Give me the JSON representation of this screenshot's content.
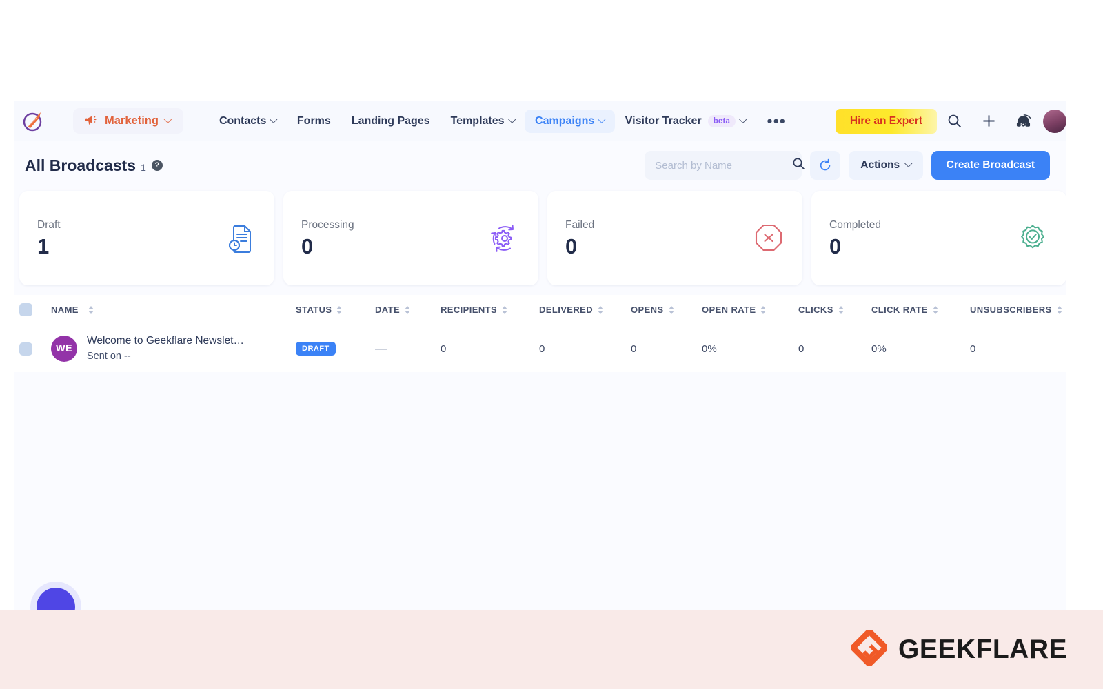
{
  "topnav": {
    "brand_icon": "geekflare-rocket-logo",
    "workspace": {
      "label": "Marketing",
      "icon": "megaphone-icon"
    },
    "items": [
      {
        "label": "Contacts",
        "has_caret": true,
        "active": false
      },
      {
        "label": "Forms",
        "has_caret": false,
        "active": false
      },
      {
        "label": "Landing Pages",
        "has_caret": false,
        "active": false
      },
      {
        "label": "Templates",
        "has_caret": true,
        "active": false
      },
      {
        "label": "Campaigns",
        "has_caret": true,
        "active": true
      },
      {
        "label": "Visitor Tracker",
        "has_caret": true,
        "active": false,
        "badge": "beta"
      }
    ],
    "overflow": "•••",
    "hire_label": "Hire an Expert",
    "icons": [
      "search-icon",
      "plus-icon",
      "phone-support-icon",
      "user-avatar"
    ]
  },
  "header": {
    "title": "All Broadcasts",
    "count": "1",
    "help": "?",
    "search_placeholder": "Search by Name",
    "search_value": "",
    "refresh_label": "refresh-icon",
    "actions_label": "Actions",
    "create_label": "Create Broadcast"
  },
  "cards": [
    {
      "label": "Draft",
      "value": "1",
      "icon": "document-clock-icon",
      "color": "#3b7ddd"
    },
    {
      "label": "Processing",
      "value": "0",
      "icon": "gear-sync-icon",
      "color": "#8b5cf6"
    },
    {
      "label": "Failed",
      "value": "0",
      "icon": "octagon-x-icon",
      "color": "#dd6a72"
    },
    {
      "label": "Completed",
      "value": "0",
      "icon": "badge-check-icon",
      "color": "#4caf8f"
    }
  ],
  "table": {
    "columns": [
      {
        "key": "name",
        "label": "Name"
      },
      {
        "key": "status",
        "label": "Status"
      },
      {
        "key": "date",
        "label": "Date"
      },
      {
        "key": "recipients",
        "label": "Recipients"
      },
      {
        "key": "delivered",
        "label": "Delivered"
      },
      {
        "key": "opens",
        "label": "Opens"
      },
      {
        "key": "open_rate",
        "label": "Open Rate"
      },
      {
        "key": "clicks",
        "label": "Clicks"
      },
      {
        "key": "click_rate",
        "label": "Click Rate"
      },
      {
        "key": "unsubscribers",
        "label": "Unsubscribers"
      }
    ],
    "rows": [
      {
        "avatar_initials": "WE",
        "avatar_color": "#9333a8",
        "name": "Welcome to Geekflare Newslet…",
        "sent_on": "Sent on --",
        "status": "DRAFT",
        "date": "—",
        "recipients": "0",
        "delivered": "0",
        "opens": "0",
        "open_rate": "0%",
        "clicks": "0",
        "click_rate": "0%",
        "unsubscribers": "0"
      }
    ]
  },
  "chat_fab": "chat-support-button",
  "footer": {
    "brand": "GEEKFLARE",
    "logo_icon": "geekflare-diamond-logo",
    "accent": "#f05a28"
  }
}
